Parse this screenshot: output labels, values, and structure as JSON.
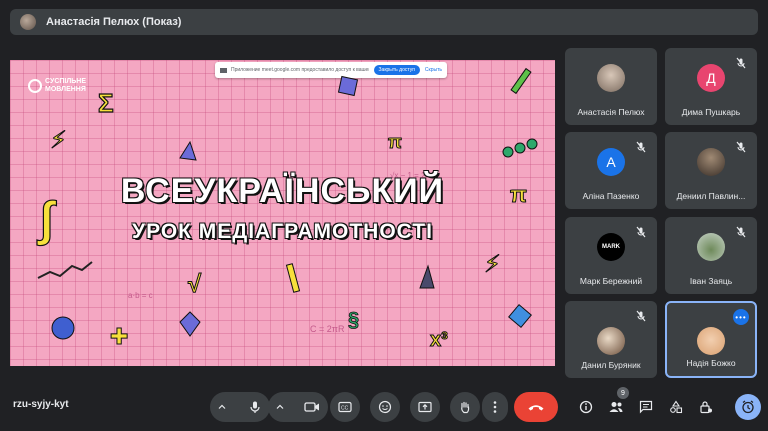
{
  "presenter_bar": {
    "title": "Анастасія Пелюх (Показ)"
  },
  "presentation": {
    "share_banner": {
      "text": "Приложение meet.google.com предоставило доступ к вашему экрану",
      "stop_label": "Закрыть доступ",
      "hide_label": "Скрыть"
    },
    "logo_text": "СУСПІЛЬНЕ МОВЛЕННЯ",
    "headline_line1": "ВСЕУКРАЇНСЬКИЙ",
    "headline_line2": "УРОК МЕДІАГРАМОТНОСТІ"
  },
  "participants": [
    {
      "name": "Анастасія Пелюх",
      "avatar": "photo",
      "muted": false
    },
    {
      "name": "Дима Пушкарь",
      "avatar_letter": "Д",
      "avatar_color": "#e8456f",
      "muted": true
    },
    {
      "name": "Аліна Пазенко",
      "avatar_letter": "А",
      "avatar_color": "#1a73e8",
      "muted": true
    },
    {
      "name": "Дениил Павлин...",
      "avatar": "photo",
      "muted": true
    },
    {
      "name": "Марк Бережний",
      "avatar_text": "MARK",
      "avatar_color": "#000000",
      "muted": true
    },
    {
      "name": "Іван Заяць",
      "avatar": "photo",
      "muted": true
    },
    {
      "name": "Данил Буряник",
      "avatar": "photo",
      "muted": true
    },
    {
      "name": "Надія Божко",
      "avatar": "photo",
      "active_speaker": true,
      "more_icon": "more-horiz-icon"
    }
  ],
  "bottom_bar": {
    "meeting_code": "rzu-syjy-kyt",
    "participant_count": "9"
  },
  "colors": {
    "end_call": "#ea4335",
    "accent": "#8ab4f8",
    "slide_bg": "#f4a7c2"
  }
}
